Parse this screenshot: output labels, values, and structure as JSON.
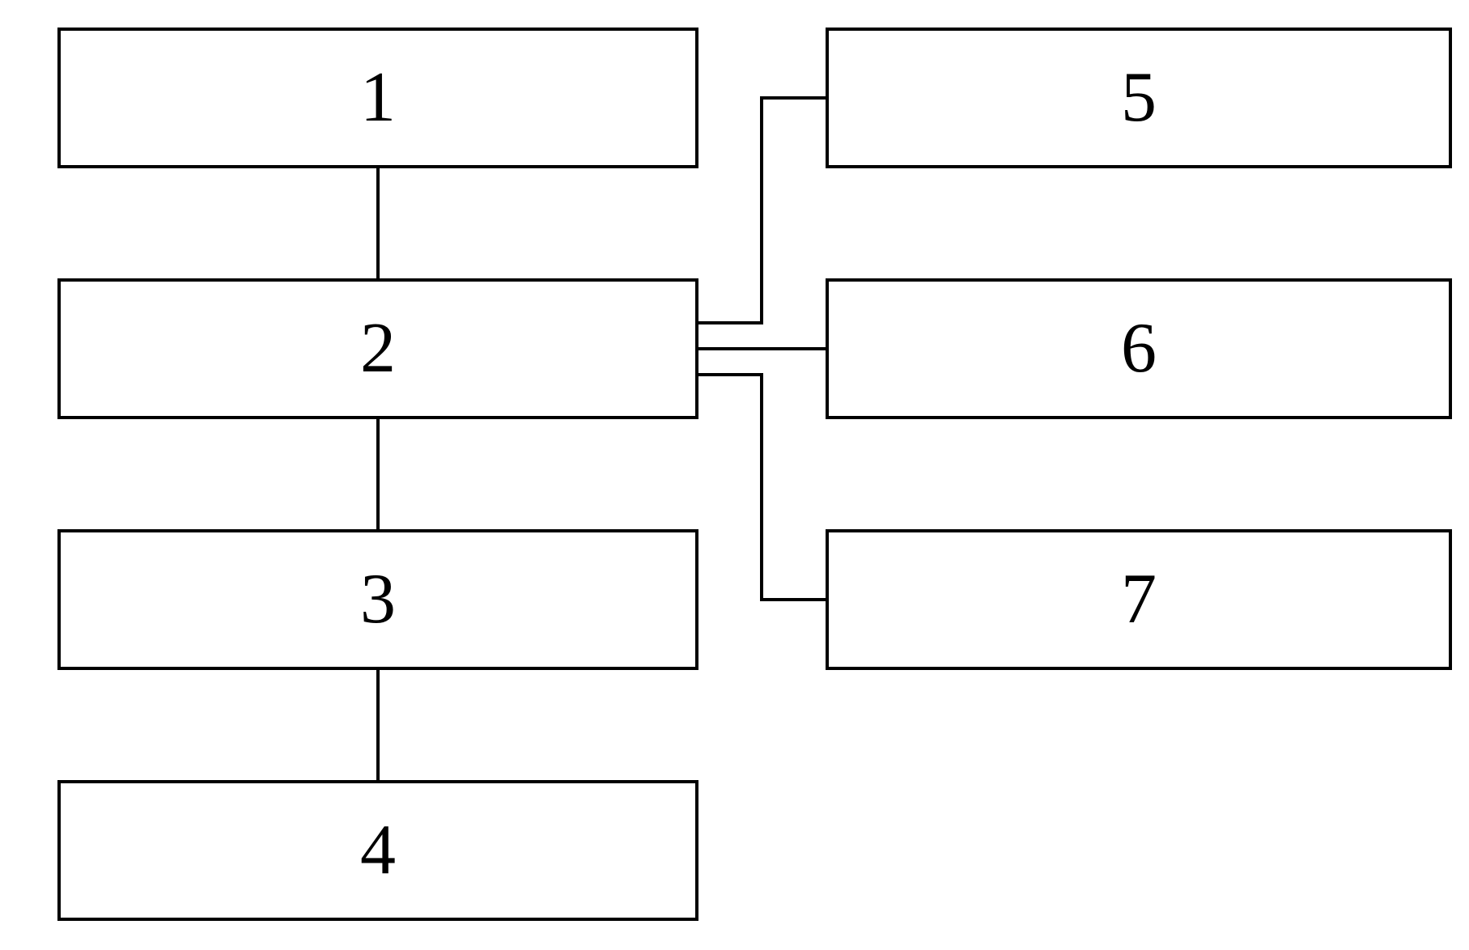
{
  "boxes": {
    "b1": "1",
    "b2": "2",
    "b3": "3",
    "b4": "4",
    "b5": "5",
    "b6": "6",
    "b7": "7"
  },
  "connections": [
    {
      "from": "b1",
      "to": "b2"
    },
    {
      "from": "b2",
      "to": "b3"
    },
    {
      "from": "b3",
      "to": "b4"
    },
    {
      "from": "b2",
      "to": "b5"
    },
    {
      "from": "b2",
      "to": "b6"
    },
    {
      "from": "b2",
      "to": "b7"
    }
  ]
}
